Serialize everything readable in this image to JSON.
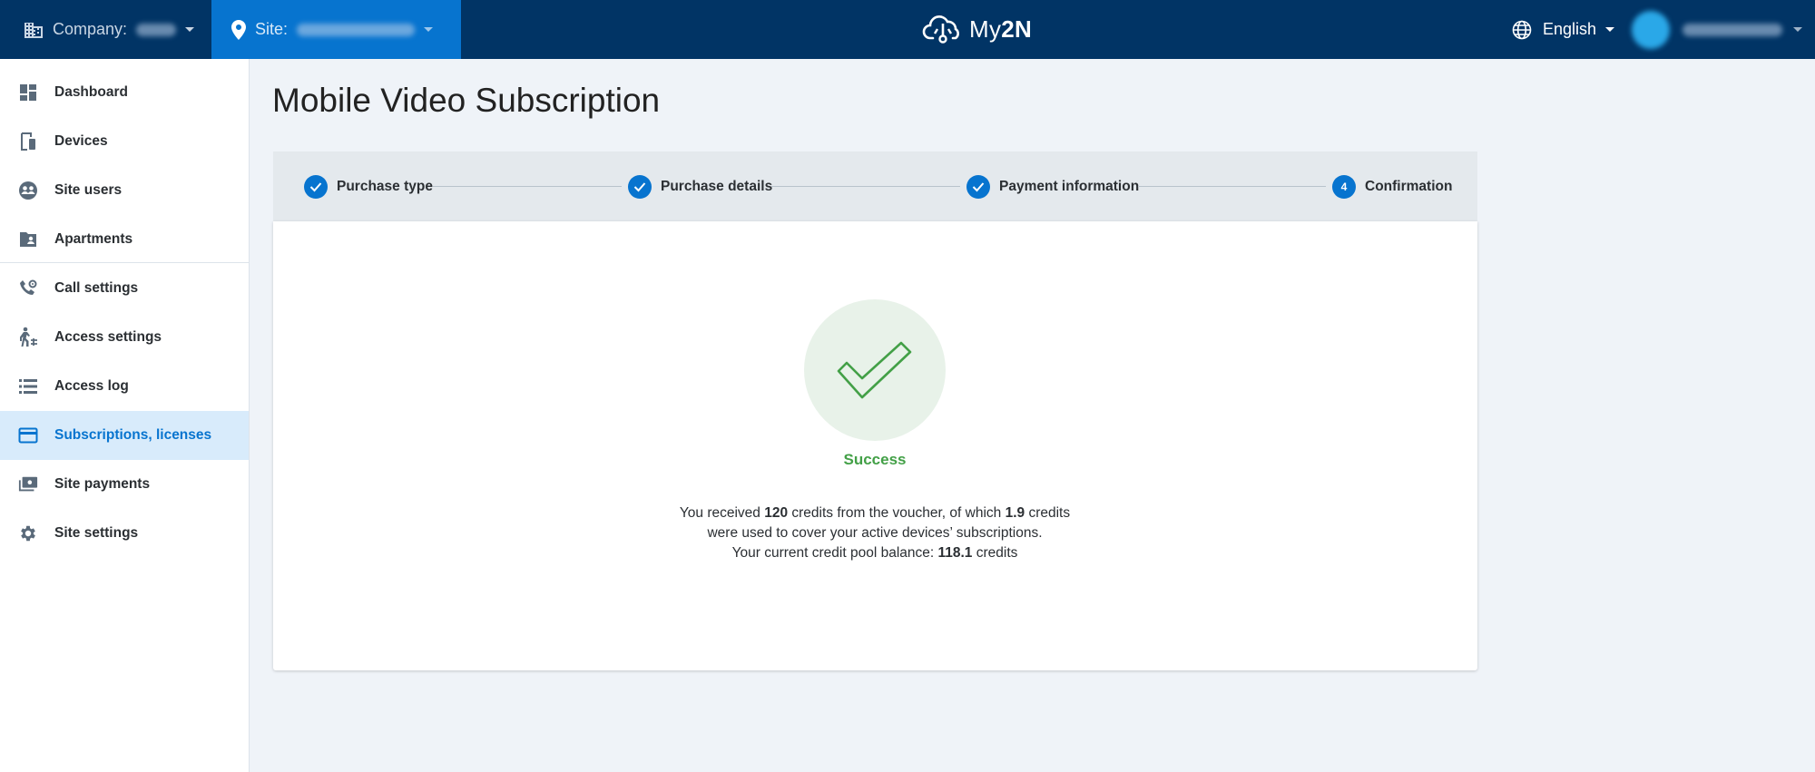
{
  "topbar": {
    "company_label": "Company:",
    "site_label": "Site:",
    "logo_prefix": "My",
    "logo_suffix": "2N",
    "language": "English"
  },
  "sidebar": {
    "items": [
      {
        "label": "Dashboard",
        "icon": "dashboard-icon"
      },
      {
        "label": "Devices",
        "icon": "devices-icon"
      },
      {
        "label": "Site users",
        "icon": "site-users-icon"
      },
      {
        "label": "Apartments",
        "icon": "apartments-icon"
      },
      {
        "label": "Call settings",
        "icon": "call-settings-icon"
      },
      {
        "label": "Access settings",
        "icon": "access-settings-icon"
      },
      {
        "label": "Access log",
        "icon": "access-log-icon"
      },
      {
        "label": "Subscriptions, licenses",
        "icon": "credit-card-icon"
      },
      {
        "label": "Site payments",
        "icon": "payments-icon"
      },
      {
        "label": "Site settings",
        "icon": "gear-icon"
      }
    ],
    "active_index": 7
  },
  "page": {
    "title": "Mobile Video Subscription"
  },
  "stepper": {
    "steps": [
      {
        "label": "Purchase type",
        "state": "done"
      },
      {
        "label": "Purchase details",
        "state": "done"
      },
      {
        "label": "Payment information",
        "state": "done"
      },
      {
        "label": "Confirmation",
        "state": "current",
        "number": "4"
      }
    ]
  },
  "result": {
    "status": "Success",
    "line1_a": "You received ",
    "line1_credits": "120",
    "line1_b": " credits from the voucher, of which ",
    "line1_used": "1.9",
    "line1_c": " credits",
    "line2": "were used to cover your active devices’ subscriptions.",
    "line3_a": "Your current credit pool balance: ",
    "line3_balance": "118.1",
    "line3_b": " credits"
  },
  "colors": {
    "topbar": "#013465",
    "accent": "#0774cf",
    "success": "#43a047"
  }
}
